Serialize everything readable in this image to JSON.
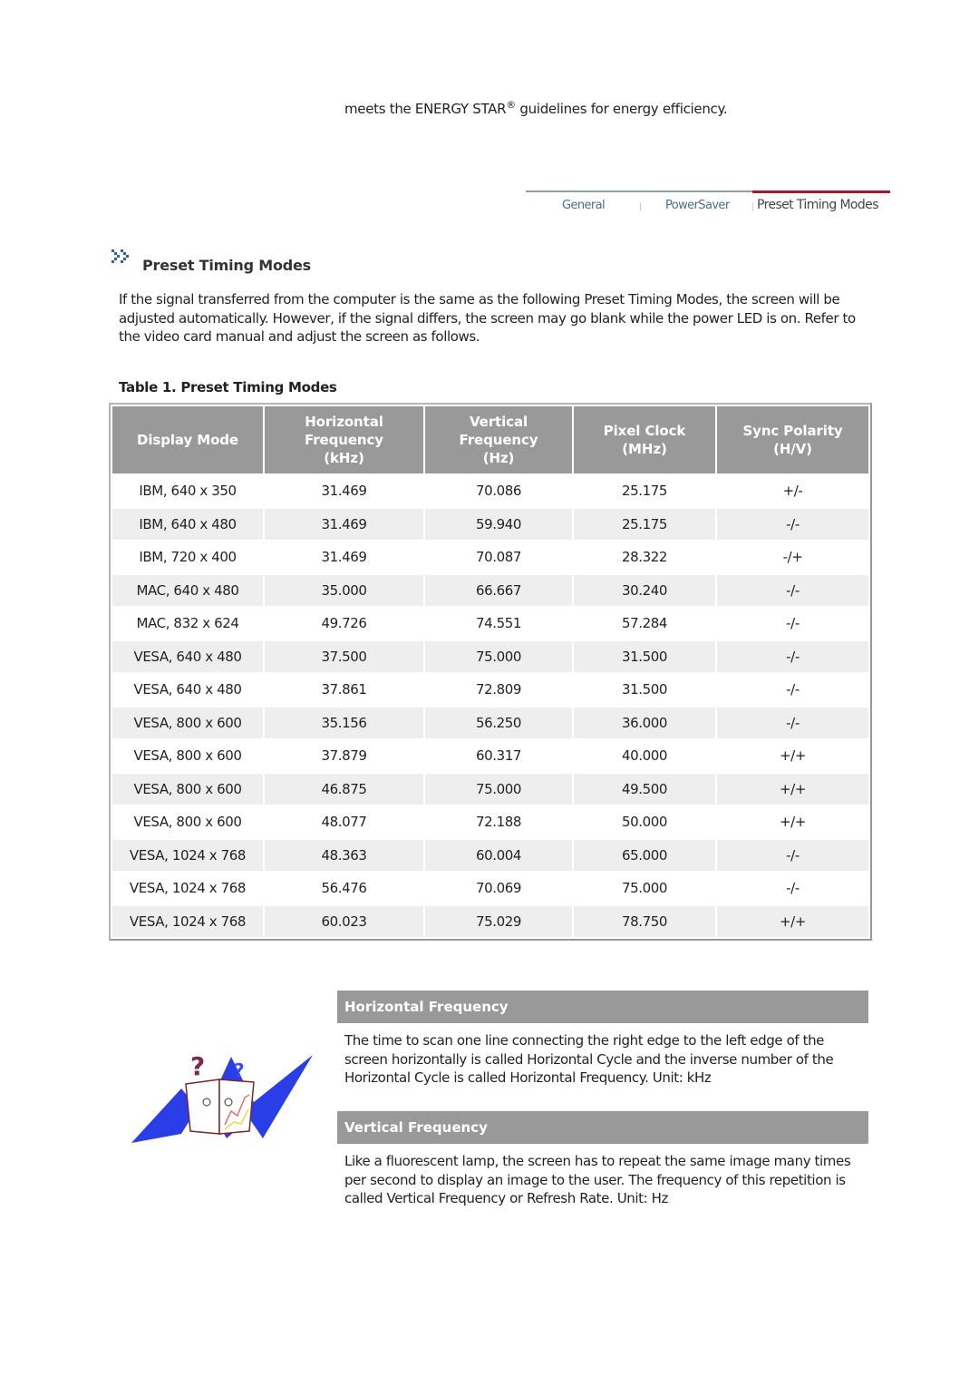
{
  "intro_line": {
    "before": "meets the ENERGY STAR",
    "mark": "®",
    "after": " guidelines for energy efficiency."
  },
  "nav": {
    "tabs": [
      {
        "label": "General",
        "active": false
      },
      {
        "label": "PowerSaver",
        "active": false
      },
      {
        "label": "Preset Timing Modes",
        "active": true
      }
    ],
    "active_color": "#a8182a"
  },
  "section": {
    "icon": "double-chevron-right-icon",
    "title": "Preset Timing Modes",
    "description": "If the signal transferred from the computer is the same as the following Preset Timing Modes, the screen will be adjusted automatically. However, if the signal differs, the screen may go blank while the power LED is on. Refer to the video card manual and adjust the screen as follows."
  },
  "table": {
    "caption": "Table 1. Preset Timing Modes",
    "headers": [
      [
        "Display Mode"
      ],
      [
        "Horizontal",
        "Frequency",
        "(kHz)"
      ],
      [
        "Vertical",
        "Frequency",
        "(Hz)"
      ],
      [
        "Pixel Clock",
        "(MHz)"
      ],
      [
        "Sync Polarity",
        "(H/V)"
      ]
    ],
    "rows": [
      [
        "IBM, 640 x 350",
        "31.469",
        "70.086",
        "25.175",
        "+/-"
      ],
      [
        "IBM, 640 x 480",
        "31.469",
        "59.940",
        "25.175",
        "-/-"
      ],
      [
        "IBM, 720 x 400",
        "31.469",
        "70.087",
        "28.322",
        "-/+"
      ],
      [
        "MAC, 640 x 480",
        "35.000",
        "66.667",
        "30.240",
        "-/-"
      ],
      [
        "MAC, 832 x 624",
        "49.726",
        "74.551",
        "57.284",
        "-/-"
      ],
      [
        "VESA, 640 x 480",
        "37.500",
        "75.000",
        "31.500",
        "-/-"
      ],
      [
        "VESA, 640 x 480",
        "37.861",
        "72.809",
        "31.500",
        "-/-"
      ],
      [
        "VESA, 800 x 600",
        "35.156",
        "56.250",
        "36.000",
        "-/-"
      ],
      [
        "VESA, 800 x 600",
        "37.879",
        "60.317",
        "40.000",
        "+/+"
      ],
      [
        "VESA, 800 x 600",
        "46.875",
        "75.000",
        "49.500",
        "+/+"
      ],
      [
        "VESA, 800 x 600",
        "48.077",
        "72.188",
        "50.000",
        "+/+"
      ],
      [
        "VESA, 1024 x 768",
        "48.363",
        "60.004",
        "65.000",
        "-/-"
      ],
      [
        "VESA, 1024 x 768",
        "56.476",
        "70.069",
        "75.000",
        "-/-"
      ],
      [
        "VESA, 1024 x 768",
        "60.023",
        "75.029",
        "78.750",
        "+/+"
      ]
    ]
  },
  "definitions": [
    {
      "title": "Horizontal Frequency",
      "text": "The time to scan one line connecting the right edge to the left edge of the screen horizontally is called Horizontal Cycle and the inverse number of the Horizontal Cycle is called Horizontal Frequency. Unit: kHz"
    },
    {
      "title": "Vertical Frequency",
      "text": "Like a fluorescent lamp, the screen has to repeat the same image many times per second to display an image to the user. The frequency of this repetition is called Vertical Frequency or Refresh Rate. Unit: Hz"
    }
  ],
  "illustration": "confused-book-mascot-icon"
}
